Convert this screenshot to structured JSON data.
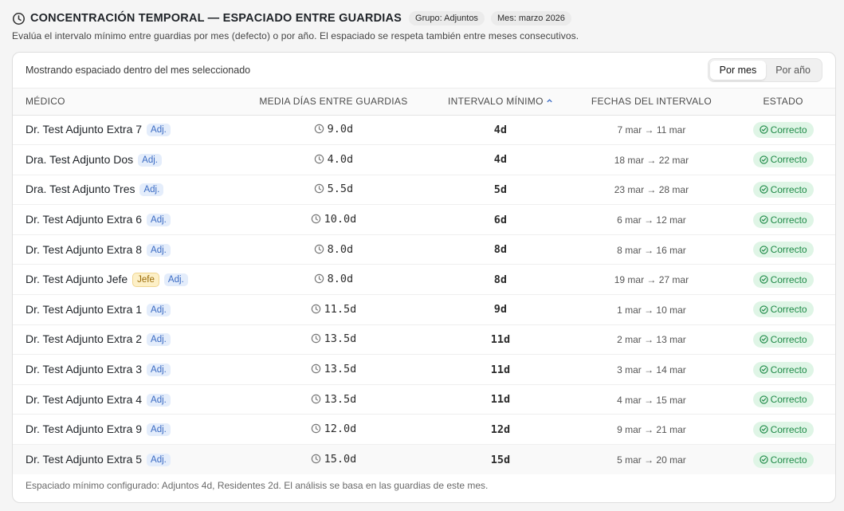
{
  "header": {
    "title": "CONCENTRACIÓN TEMPORAL — ESPACIADO ENTRE GUARDIAS",
    "group_chip": "Grupo: Adjuntos",
    "month_chip": "Mes: marzo 2026",
    "subtitle": "Evalúa el intervalo mínimo entre guardias por mes (defecto) o por año. El espaciado se respeta también entre meses consecutivos."
  },
  "card": {
    "showing_text": "Mostrando espaciado dentro del mes seleccionado",
    "toggle": {
      "month": "Por mes",
      "year": "Por año",
      "active": "month"
    },
    "columns": {
      "name": "MÉDICO",
      "avg": "MEDIA DÍAS ENTRE GUARDIAS",
      "interval": "INTERVALO MÍNIMO",
      "dates": "FECHAS DEL INTERVALO",
      "status": "ESTADO"
    },
    "rows": [
      {
        "name": "Dr. Test Adjunto Extra 7",
        "badges": [
          "Adj."
        ],
        "avg": "9.0d",
        "interval": "4d",
        "dates": "7 mar → 11 mar",
        "status": "Correcto"
      },
      {
        "name": "Dra. Test Adjunto Dos",
        "badges": [
          "Adj."
        ],
        "avg": "4.0d",
        "interval": "4d",
        "dates": "18 mar → 22 mar",
        "status": "Correcto"
      },
      {
        "name": "Dra. Test Adjunto Tres",
        "badges": [
          "Adj."
        ],
        "avg": "5.5d",
        "interval": "5d",
        "dates": "23 mar → 28 mar",
        "status": "Correcto"
      },
      {
        "name": "Dr. Test Adjunto Extra 6",
        "badges": [
          "Adj."
        ],
        "avg": "10.0d",
        "interval": "6d",
        "dates": "6 mar → 12 mar",
        "status": "Correcto"
      },
      {
        "name": "Dr. Test Adjunto Extra 8",
        "badges": [
          "Adj."
        ],
        "avg": "8.0d",
        "interval": "8d",
        "dates": "8 mar → 16 mar",
        "status": "Correcto"
      },
      {
        "name": "Dr. Test Adjunto Jefe",
        "badges": [
          "Jefe",
          "Adj."
        ],
        "avg": "8.0d",
        "interval": "8d",
        "dates": "19 mar → 27 mar",
        "status": "Correcto"
      },
      {
        "name": "Dr. Test Adjunto Extra 1",
        "badges": [
          "Adj."
        ],
        "avg": "11.5d",
        "interval": "9d",
        "dates": "1 mar → 10 mar",
        "status": "Correcto"
      },
      {
        "name": "Dr. Test Adjunto Extra 2",
        "badges": [
          "Adj."
        ],
        "avg": "13.5d",
        "interval": "11d",
        "dates": "2 mar → 13 mar",
        "status": "Correcto"
      },
      {
        "name": "Dr. Test Adjunto Extra 3",
        "badges": [
          "Adj."
        ],
        "avg": "13.5d",
        "interval": "11d",
        "dates": "3 mar → 14 mar",
        "status": "Correcto"
      },
      {
        "name": "Dr. Test Adjunto Extra 4",
        "badges": [
          "Adj."
        ],
        "avg": "13.5d",
        "interval": "11d",
        "dates": "4 mar → 15 mar",
        "status": "Correcto"
      },
      {
        "name": "Dr. Test Adjunto Extra 9",
        "badges": [
          "Adj."
        ],
        "avg": "12.0d",
        "interval": "12d",
        "dates": "9 mar → 21 mar",
        "status": "Correcto"
      },
      {
        "name": "Dr. Test Adjunto Extra 5",
        "badges": [
          "Adj."
        ],
        "avg": "15.0d",
        "interval": "15d",
        "dates": "5 mar → 20 mar",
        "status": "Correcto"
      }
    ],
    "footnote": "Espaciado mínimo configurado: Adjuntos 4d, Residentes 2d. El análisis se basa en las guardias de este mes."
  },
  "icons": {
    "title": "clock-icon",
    "avg": "clock-icon",
    "status": "check-circle-icon",
    "sort": "sort-ascending-icon"
  },
  "colors": {
    "status_bg": "#dff5e6",
    "status_text": "#1e8a47",
    "adj_bg": "#e4edfb",
    "adj_text": "#3a6bc4",
    "jefe_bg": "#fdf0c7",
    "jefe_text": "#9a6a06"
  }
}
